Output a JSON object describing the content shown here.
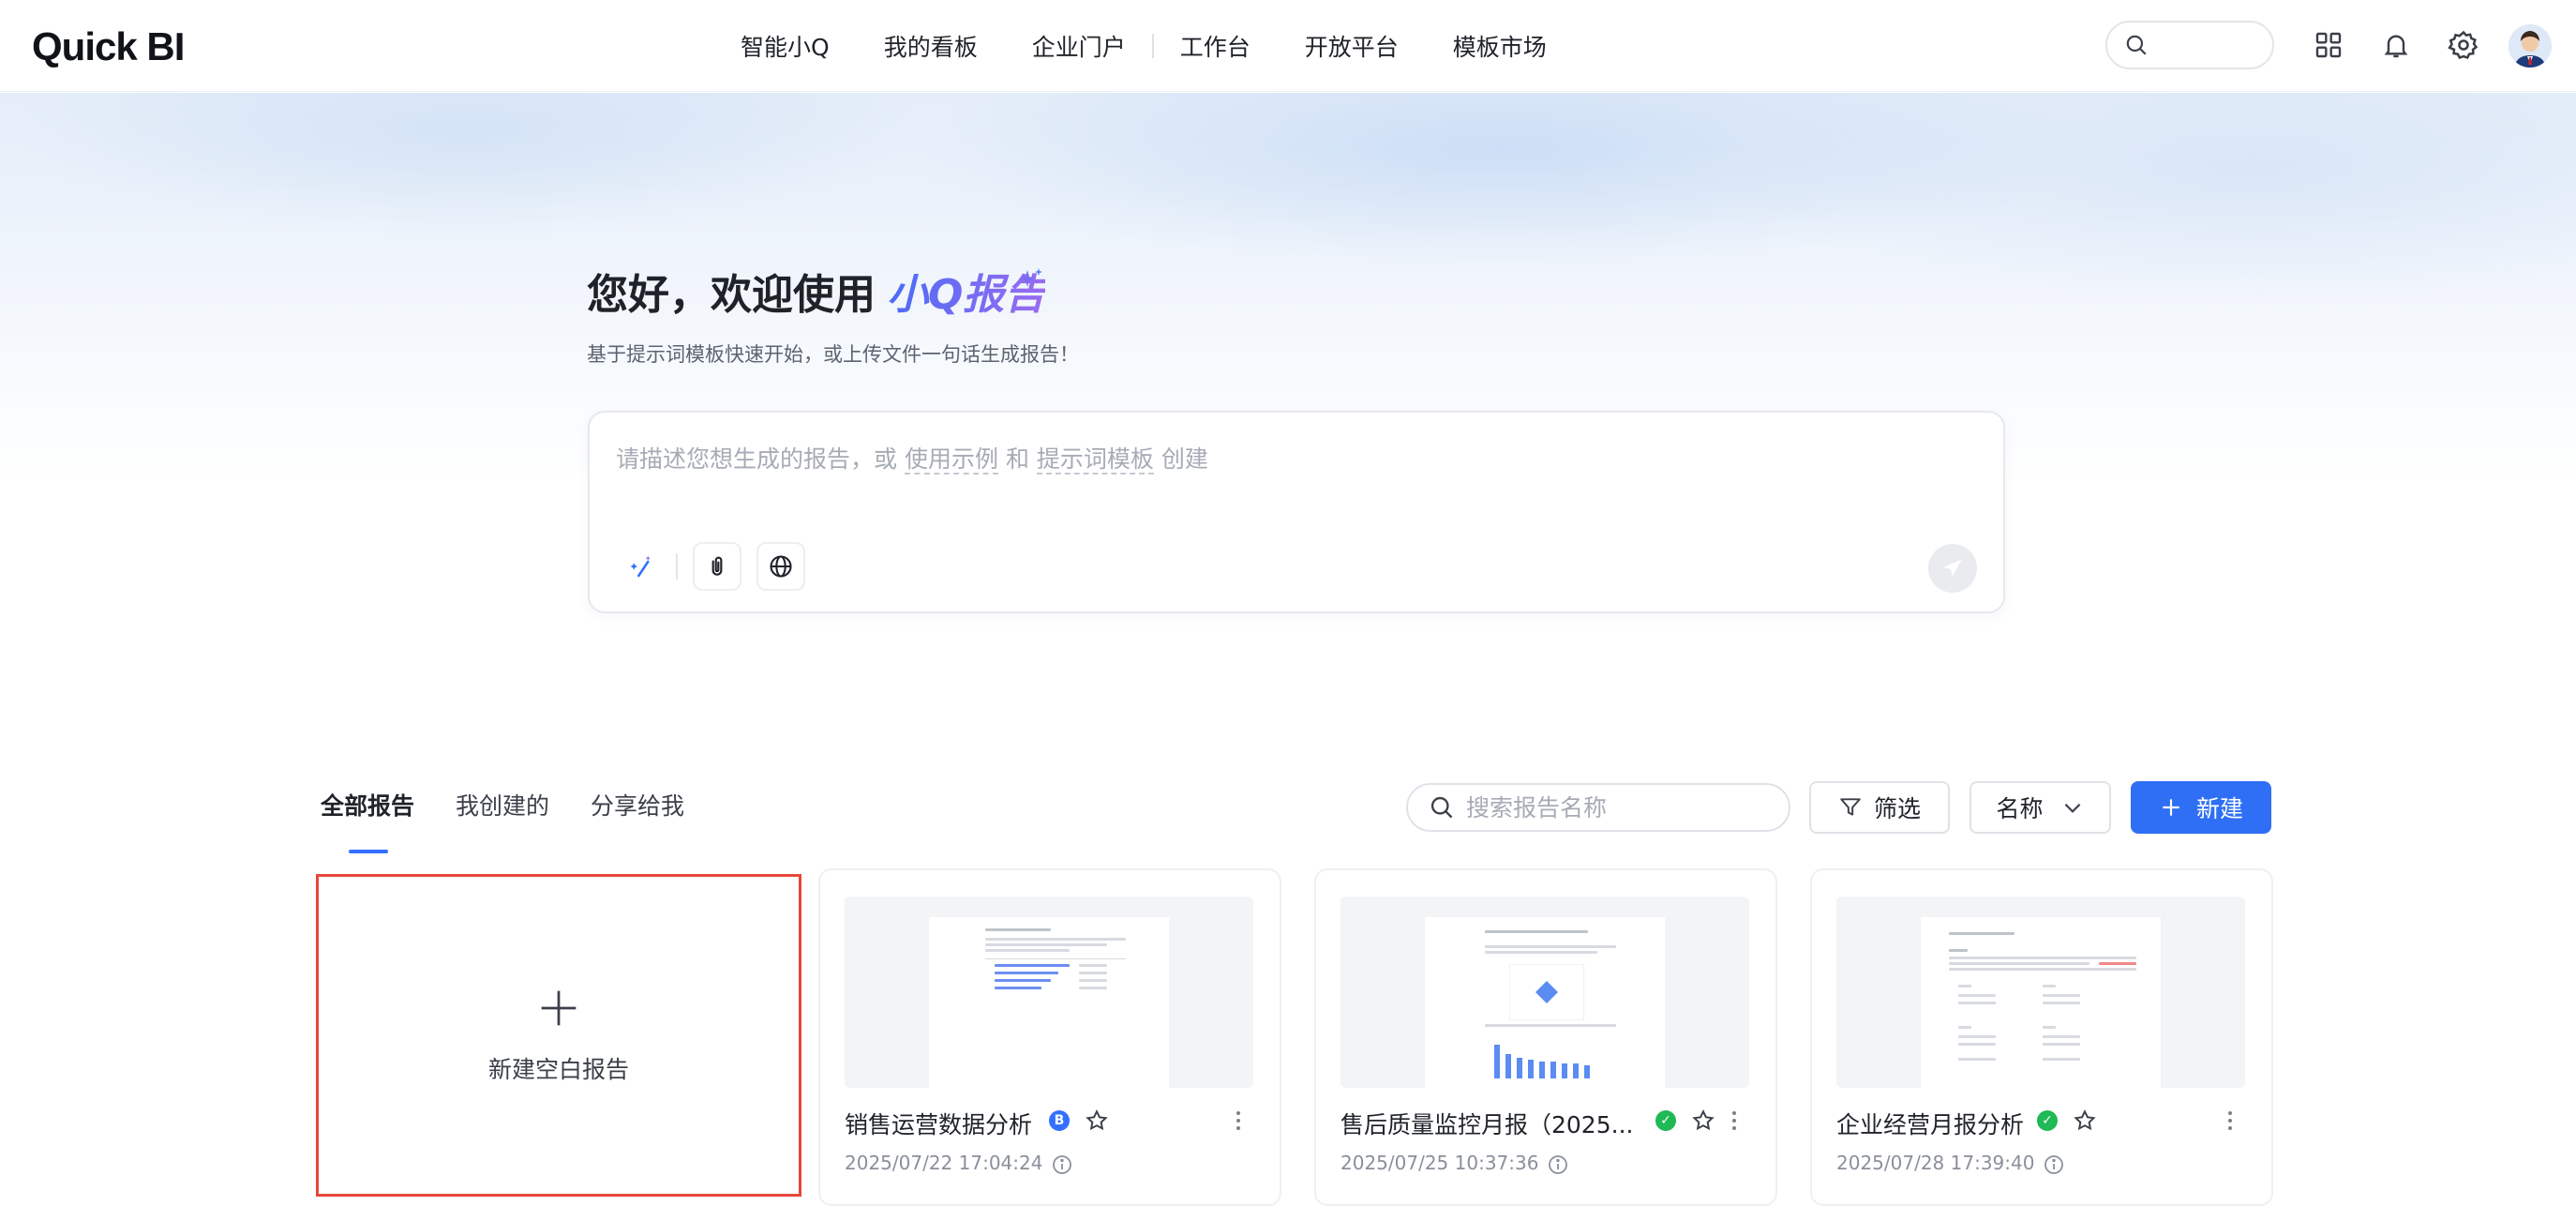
{
  "app": {
    "logo_text": "Quick BI"
  },
  "nav": {
    "items": [
      "智能小Q",
      "我的看板",
      "企业门户",
      "工作台",
      "开放平台",
      "模板市场"
    ]
  },
  "top_icons": [
    "search-icon",
    "apps-grid-icon",
    "bell-icon",
    "gear-icon",
    "avatar"
  ],
  "hero": {
    "title_prefix": "您好，欢迎使用",
    "title_accent": "小Q报告",
    "subtitle": "基于提示词模板快速开始，或上传文件一句话生成报告！",
    "prompt": {
      "placeholder_pre": "请描述您想生成的报告，或",
      "link_examples": "使用示例",
      "placeholder_mid": "和",
      "link_templates": "提示词模板",
      "placeholder_post": "创建"
    }
  },
  "tabs": [
    "全部报告",
    "我创建的",
    "分享给我"
  ],
  "toolbar": {
    "search_placeholder": "搜索报告名称",
    "filter_label": "筛选",
    "sort_label": "名称",
    "new_label": "新建"
  },
  "new_blank": {
    "label": "新建空白报告"
  },
  "reports": [
    {
      "title": "销售运营数据分析",
      "date": "2025/07/22 17:04:24",
      "badge": "B",
      "badge_color": "#3370ff"
    },
    {
      "title": "售后质量监控月报（2025...",
      "date": "2025/07/25 10:37:36",
      "badge": "✓",
      "badge_color": "#1fb955"
    },
    {
      "title": "企业经营月报分析",
      "date": "2025/07/28 17:39:40",
      "badge": "✓",
      "badge_color": "#1fb955"
    }
  ],
  "colors": {
    "accent": "#3370ff",
    "primary_button": "#2f6ff5",
    "highlight_border": "#e8463a"
  }
}
